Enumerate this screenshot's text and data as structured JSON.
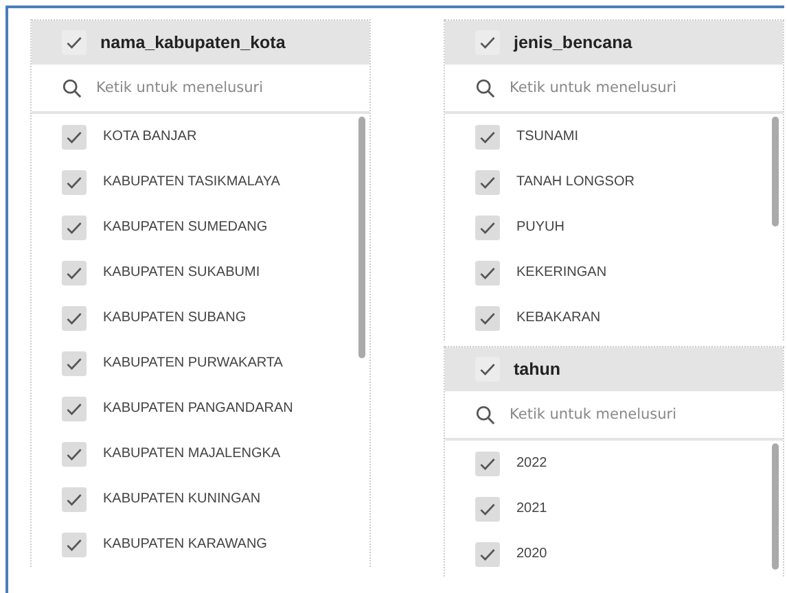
{
  "columns": [
    {
      "panels": [
        {
          "header": {
            "label": "nama_kabupaten_kota",
            "checked": true
          },
          "search": {
            "placeholder": "Ketik untuk menelusuri"
          },
          "items": [
            {
              "label": "KOTA BANJAR",
              "checked": true
            },
            {
              "label": "KABUPATEN TASIKMALAYA",
              "checked": true
            },
            {
              "label": "KABUPATEN SUMEDANG",
              "checked": true
            },
            {
              "label": "KABUPATEN SUKABUMI",
              "checked": true
            },
            {
              "label": "KABUPATEN SUBANG",
              "checked": true
            },
            {
              "label": "KABUPATEN PURWAKARTA",
              "checked": true
            },
            {
              "label": "KABUPATEN PANGANDARAN",
              "checked": true
            },
            {
              "label": "KABUPATEN MAJALENGKA",
              "checked": true
            },
            {
              "label": "KABUPATEN KUNINGAN",
              "checked": true
            },
            {
              "label": "KABUPATEN KARAWANG",
              "checked": true
            }
          ]
        }
      ]
    },
    {
      "panels": [
        {
          "header": {
            "label": "jenis_bencana",
            "checked": true
          },
          "search": {
            "placeholder": "Ketik untuk menelusuri"
          },
          "items": [
            {
              "label": "TSUNAMI",
              "checked": true
            },
            {
              "label": "TANAH LONGSOR",
              "checked": true
            },
            {
              "label": "PUYUH",
              "checked": true
            },
            {
              "label": "KEKERINGAN",
              "checked": true
            },
            {
              "label": "KEBAKARAN",
              "checked": true
            }
          ]
        },
        {
          "header": {
            "label": "tahun",
            "checked": true
          },
          "search": {
            "placeholder": "Ketik untuk menelusuri"
          },
          "items": [
            {
              "label": "2022",
              "checked": true
            },
            {
              "label": "2021",
              "checked": true
            },
            {
              "label": "2020",
              "checked": true
            }
          ]
        }
      ]
    }
  ]
}
